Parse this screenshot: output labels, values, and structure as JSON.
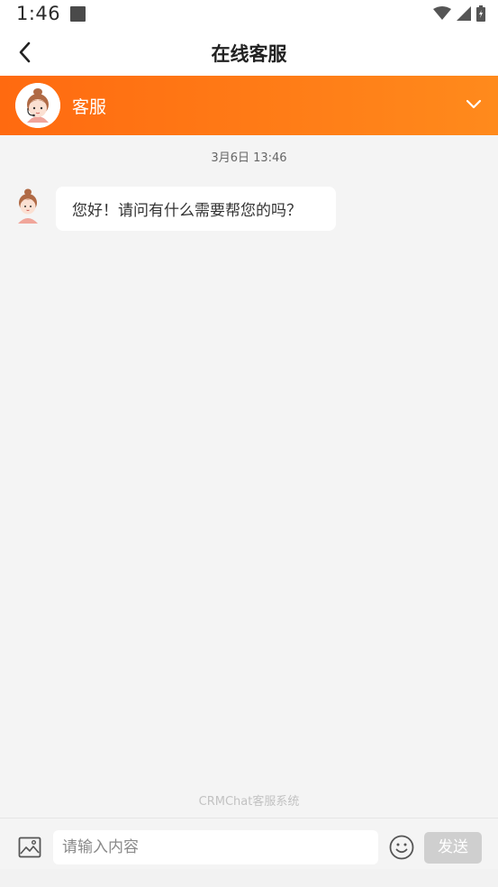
{
  "status_bar": {
    "time": "1:46"
  },
  "nav": {
    "title": "在线客服"
  },
  "agent": {
    "name": "客服"
  },
  "chat": {
    "timestamp": "3月6日 13:46",
    "messages": [
      {
        "from": "agent",
        "text": "您好！请问有什么需要帮您的吗？"
      }
    ]
  },
  "footer": {
    "brand": "CRMChat客服系统"
  },
  "input": {
    "placeholder": "请输入内容",
    "value": "",
    "send_label": "发送"
  },
  "colors": {
    "accent_start": "#ff6a10",
    "accent_end": "#ff8a1c",
    "send_disabled": "#cfcfcf"
  }
}
